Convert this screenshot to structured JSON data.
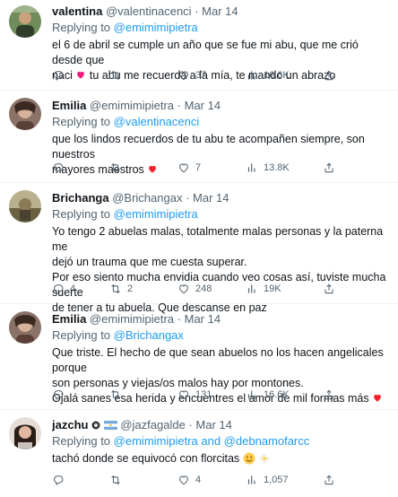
{
  "tweets": [
    {
      "name": "valentina",
      "handle": "@valentinacenci",
      "date": "Mar 14",
      "reply_prefix": "Replying to",
      "reply_to": "@emimimipietra",
      "body": [
        "el 6 de abril se cumple un año que se fue mi abu, que me crió desde que",
        "naci",
        "tu abu me recuerda a la mía,  te mando un abrazo"
      ],
      "stats": {
        "replies": "",
        "retweets": "",
        "likes": "37",
        "views": "16.6K"
      }
    },
    {
      "name": "Emilia",
      "handle": "@emimimipietra",
      "date": "Mar 14",
      "reply_prefix": "Replying to",
      "reply_to": "@valentinacenci",
      "body": [
        "que los lindos recuerdos de tu abu te acompañen siempre, son nuestros",
        "mayores maestros"
      ],
      "stats": {
        "replies": "",
        "retweets": "",
        "likes": "7",
        "views": "13.8K"
      }
    },
    {
      "name": "Brichanga",
      "handle": "@Brichangax",
      "date": "Mar 14",
      "reply_prefix": "Replying to",
      "reply_to": "@emimimipietra",
      "body": [
        "Yo tengo 2 abuelas malas, totalmente malas personas y la paterna me",
        "dejó un trauma que me cuesta superar.",
        "Por eso siento mucha envidia cuando veo cosas así, tuviste mucha suerte",
        "de tener a tu abuela. Que descanse en paz"
      ],
      "stats": {
        "replies": "4",
        "retweets": "2",
        "likes": "248",
        "views": "19K"
      }
    },
    {
      "name": "Emilia",
      "handle": "@emimimipietra",
      "date": "Mar 14",
      "reply_prefix": "Replying to",
      "reply_to": "@Brichangax",
      "body": [
        "Que triste. El hecho de que sean abuelos no los hacen angelicales porque",
        "son personas y viejas/os malos hay por montones.",
        "Ojalá sanes esa herida y encuentres el amor de mil formas más"
      ],
      "stats": {
        "replies": "",
        "retweets": "",
        "likes": "131",
        "views": "16.6K"
      }
    },
    {
      "name": "jazchu",
      "handle": "@jazfagalde",
      "date": "Mar 14",
      "reply_prefix": "Replying to",
      "reply_to": "@emimimipietra and @debnamofarcc",
      "body": [
        "tachó donde se equivocó con florcitas"
      ],
      "stats": {
        "replies": "",
        "retweets": "",
        "likes": "4",
        "views": "1,057"
      }
    }
  ],
  "separator": "·",
  "colors": {
    "link": "#1d9bf0",
    "muted": "#536471",
    "heart": "#f4212e",
    "text": "#0f1419"
  },
  "icons": [
    "reply-icon",
    "retweet-icon",
    "like-icon",
    "views-icon",
    "share-icon"
  ]
}
